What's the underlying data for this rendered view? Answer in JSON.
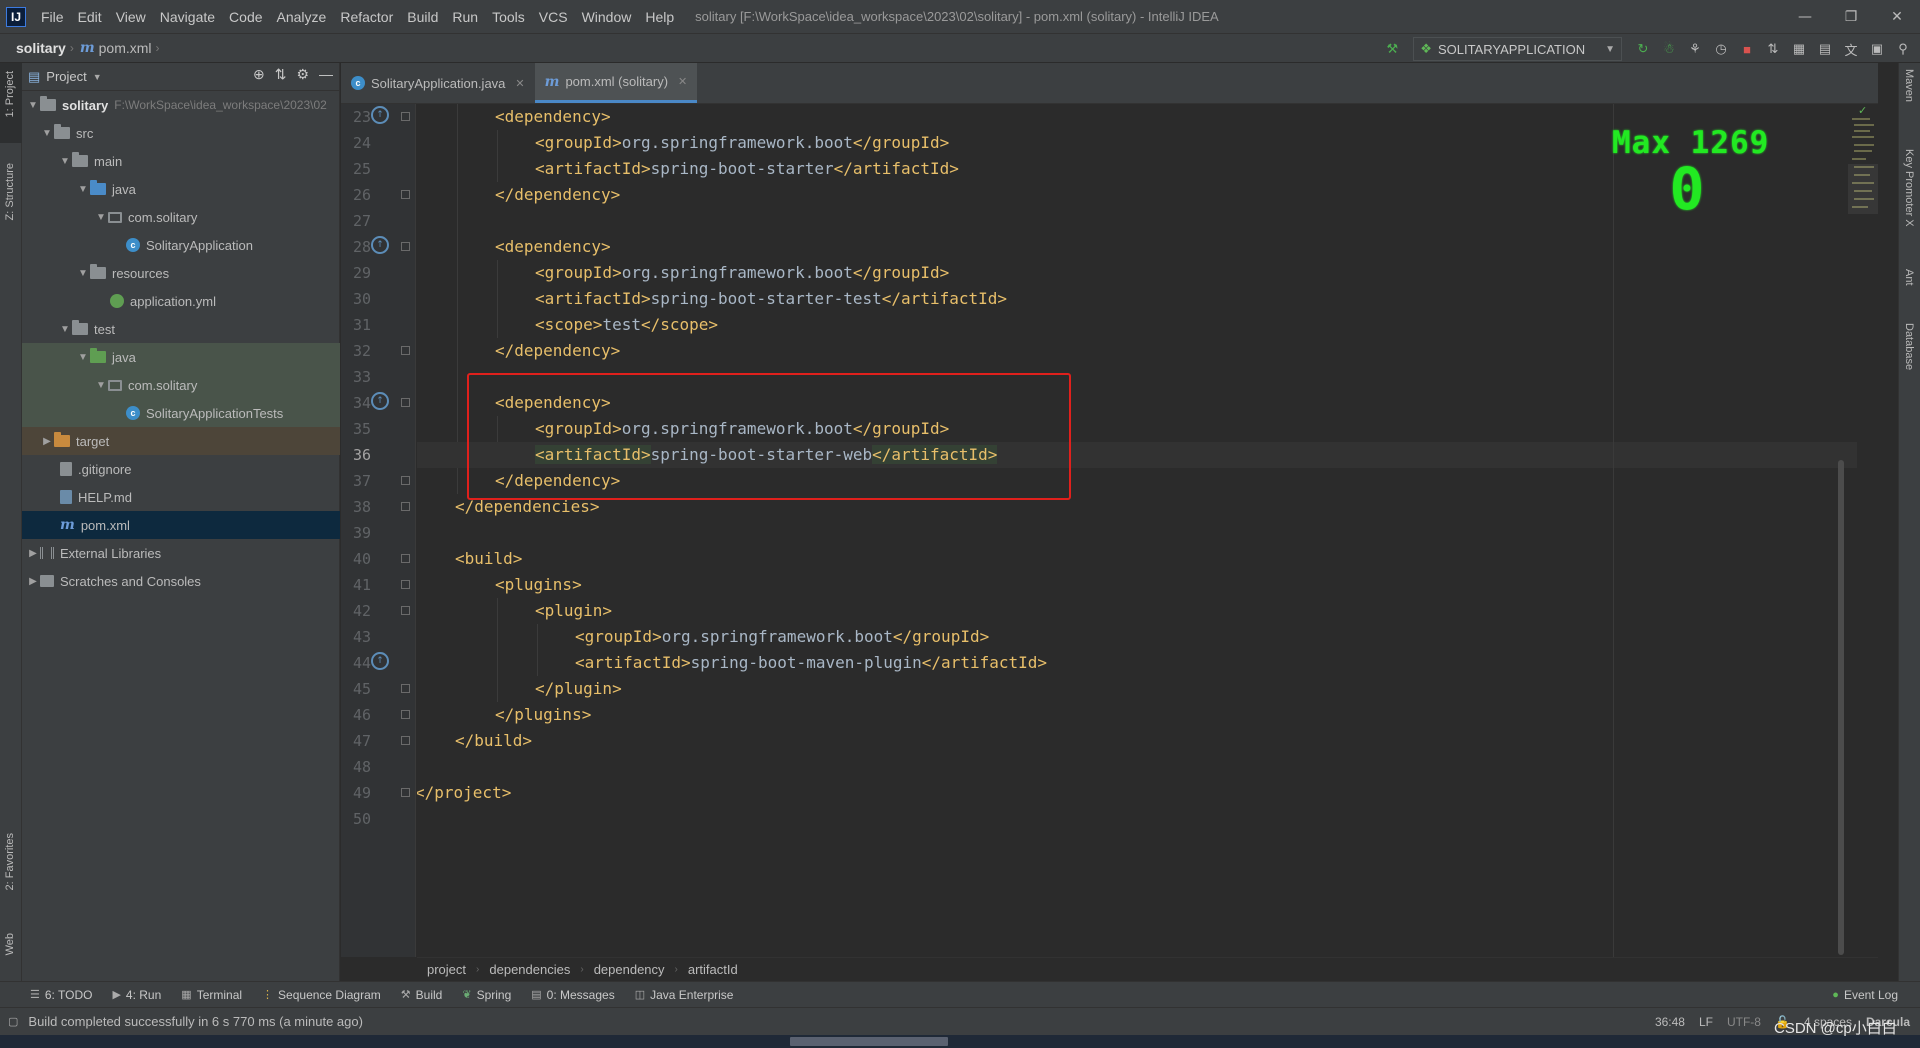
{
  "menubar": {
    "logo": "IJ",
    "items": [
      "File",
      "Edit",
      "View",
      "Navigate",
      "Code",
      "Analyze",
      "Refactor",
      "Build",
      "Run",
      "Tools",
      "VCS",
      "Window",
      "Help"
    ],
    "window_title": "solitary [F:\\WorkSpace\\idea_workspace\\2023\\02\\solitary] - pom.xml (solitary) - IntelliJ IDEA"
  },
  "navbar": {
    "project": "solitary",
    "file": "pom.xml",
    "run_config": "SOLITARYAPPLICATION"
  },
  "left_strip": {
    "project": "1: Project",
    "structure": "Z: Structure",
    "favorites": "2: Favorites",
    "web": "Web"
  },
  "right_strip": {
    "maven": "Maven",
    "key_promoter": "Key Promoter X",
    "ant": "Ant",
    "database": "Database"
  },
  "project_panel": {
    "title": "Project",
    "root_name": "solitary",
    "root_path": "F:\\WorkSpace\\idea_workspace\\2023\\02",
    "tree": [
      "src",
      "main",
      "java",
      "com.solitary",
      "SolitaryApplication",
      "resources",
      "application.yml",
      "test",
      "java",
      "com.solitary",
      "SolitaryApplicationTests",
      "target",
      ".gitignore",
      "HELP.md",
      "pom.xml",
      "External Libraries",
      "Scratches and Consoles"
    ]
  },
  "tabs": [
    {
      "label": "SolitaryApplication.java"
    },
    {
      "label": "pom.xml (solitary)"
    }
  ],
  "editor": {
    "line_numbers": [
      "23",
      "24",
      "25",
      "26",
      "27",
      "28",
      "29",
      "30",
      "31",
      "32",
      "33",
      "34",
      "35",
      "36",
      "37",
      "38",
      "39",
      "40",
      "41",
      "42",
      "43",
      "44",
      "45",
      "46",
      "47",
      "48",
      "49",
      "50"
    ],
    "current_line": "36",
    "lines": {
      "l23_open": "<dependency>",
      "l24_g_open": "<groupId>",
      "l24_val": "org.springframework.boot",
      "l24_g_close": "</groupId>",
      "l25_a_open": "<artifactId>",
      "l25_val": "spring-boot-starter",
      "l25_a_close": "</artifactId>",
      "l26_close": "</dependency>",
      "l28_open": "<dependency>",
      "l29_g_open": "<groupId>",
      "l29_val": "org.springframework.boot",
      "l29_g_close": "</groupId>",
      "l30_a_open": "<artifactId>",
      "l30_val": "spring-boot-starter-test",
      "l30_a_close": "</artifactId>",
      "l31_s_open": "<scope>",
      "l31_val": "test",
      "l31_s_close": "</scope>",
      "l32_close": "</dependency>",
      "l34_open": "<dependency>",
      "l35_g_open": "<groupId>",
      "l35_val": "org.springframework.boot",
      "l35_g_close": "</groupId>",
      "l36_a_open": "<artifactId>",
      "l36_val": "spring-boot-starter-web",
      "l36_a_close": "</artifactId>",
      "l37_close": "</dependency>",
      "l38_close": "</dependencies>",
      "l40_open": "<build>",
      "l41_open": "<plugins>",
      "l42_open": "<plugin>",
      "l43_g_open": "<groupId>",
      "l43_val": "org.springframework.boot",
      "l43_g_close": "</groupId>",
      "l44_a_open": "<artifactId>",
      "l44_val": "spring-boot-maven-plugin",
      "l44_a_close": "</artifactId>",
      "l45_close": "</plugin>",
      "l46_close": "</plugins>",
      "l47_close": "</build>",
      "l49_close": "</project>"
    }
  },
  "overlay": {
    "max_label": "Max 1269",
    "count": "0"
  },
  "editor_breadcrumb": [
    "project",
    "dependencies",
    "dependency",
    "artifactId"
  ],
  "tool_windows": {
    "todo": "6: TODO",
    "run": "4: Run",
    "terminal": "Terminal",
    "sequence": "Sequence Diagram",
    "build": "Build",
    "spring": "Spring",
    "messages": "0: Messages",
    "java_ee": "Java Enterprise",
    "event_log": "Event Log"
  },
  "status": {
    "message": "Build completed successfully in 6 s 770 ms (a minute ago)",
    "position": "36:48",
    "line_sep": "LF",
    "encoding": "UTF-8",
    "indent": "4 spaces",
    "theme": "Darcula"
  },
  "watermark": "CSDN @cp小白白",
  "colors": {
    "tag": "#e8bf6a",
    "text": "#a9b7c6",
    "highlight_box": "#e0201c",
    "overlay": "#22e922"
  }
}
